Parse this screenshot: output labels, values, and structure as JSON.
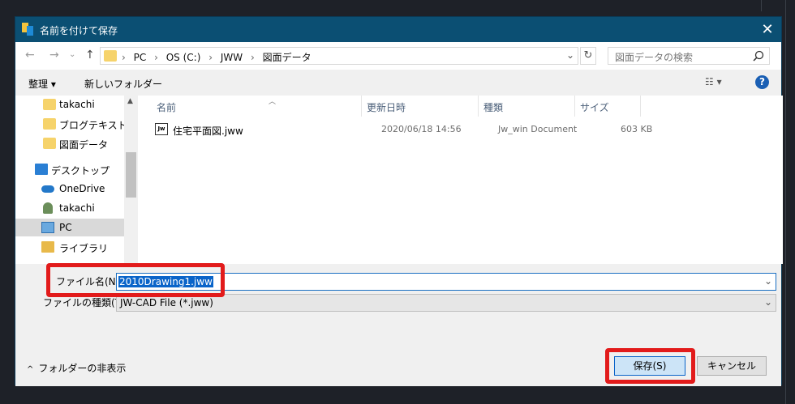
{
  "window": {
    "title": "名前を付けて保存",
    "close_symbol": "✕"
  },
  "address": {
    "crumbs": [
      "PC",
      "OS (C:)",
      "JWW",
      "図面データ"
    ],
    "separator": "›",
    "search_placeholder": "図面データの検索"
  },
  "toolbar": {
    "organize_label": "整理 ▾",
    "new_folder_label": "新しいフォルダー",
    "help_label": "?"
  },
  "nav": {
    "items": [
      {
        "label": "takachi",
        "icon": "folder-icon"
      },
      {
        "label": "ブログテキスト",
        "icon": "folder-icon"
      },
      {
        "label": "図面データ",
        "icon": "folder-icon"
      },
      {
        "label": "デスクトップ",
        "icon": "desktop-icon"
      },
      {
        "label": "OneDrive",
        "icon": "cloud-icon"
      },
      {
        "label": "takachi",
        "icon": "user-icon"
      },
      {
        "label": "PC",
        "icon": "pc-icon",
        "selected": true
      },
      {
        "label": "ライブラリ",
        "icon": "library-icon"
      }
    ]
  },
  "files": {
    "columns": [
      "名前",
      "更新日時",
      "種類",
      "サイズ"
    ],
    "rows": [
      {
        "name": "住宅平面図.jww",
        "modified": "2020/06/18 14:56",
        "type": "Jw_win Document",
        "size": "603 KB",
        "icon_text": "Jw"
      }
    ]
  },
  "form": {
    "filename_label": "ファイル名(N):",
    "filename_value": "2010Drawing1.jww",
    "filetype_label": "ファイルの種類(T):",
    "filetype_value": "JW-CAD File (*.jww)"
  },
  "footer": {
    "hide_folders_label": "フォルダーの非表示",
    "save_label": "保存(S)",
    "cancel_label": "キャンセル"
  },
  "colors": {
    "titlebar": "#0b4f73",
    "highlight": "#e21b1b",
    "selection": "#0a64c9"
  }
}
